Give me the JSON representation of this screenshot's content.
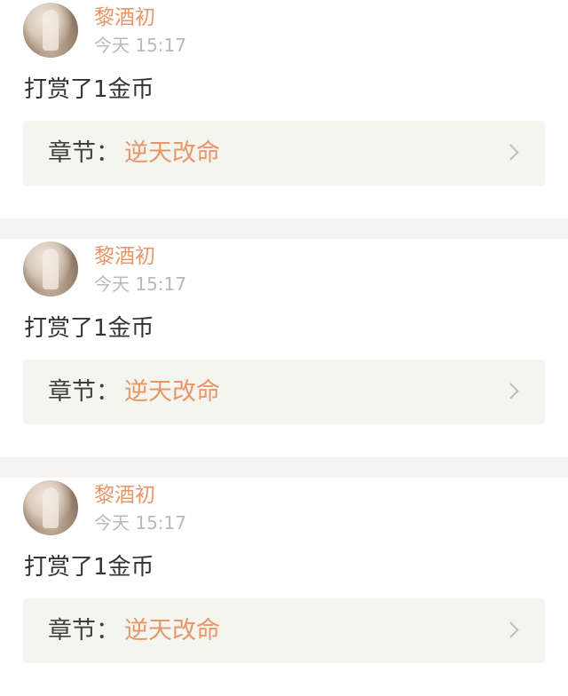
{
  "colors": {
    "accent": "#e8956a",
    "muted": "#b9b9b9",
    "text": "#333333",
    "chapter_bg": "#f5f5f0",
    "separator": "#f7f5f4"
  },
  "feed": {
    "items": [
      {
        "user_name": "黎酒初",
        "time": "今天 15:17",
        "reward_text": "打赏了1金币",
        "chapter_label": "章节：",
        "chapter_title": "逆天改命",
        "chevron_icon": "chevron-right-icon"
      },
      {
        "user_name": "黎酒初",
        "time": "今天 15:17",
        "reward_text": "打赏了1金币",
        "chapter_label": "章节：",
        "chapter_title": "逆天改命",
        "chevron_icon": "chevron-right-icon"
      },
      {
        "user_name": "黎酒初",
        "time": "今天 15:17",
        "reward_text": "打赏了1金币",
        "chapter_label": "章节：",
        "chapter_title": "逆天改命",
        "chevron_icon": "chevron-right-icon"
      }
    ]
  }
}
